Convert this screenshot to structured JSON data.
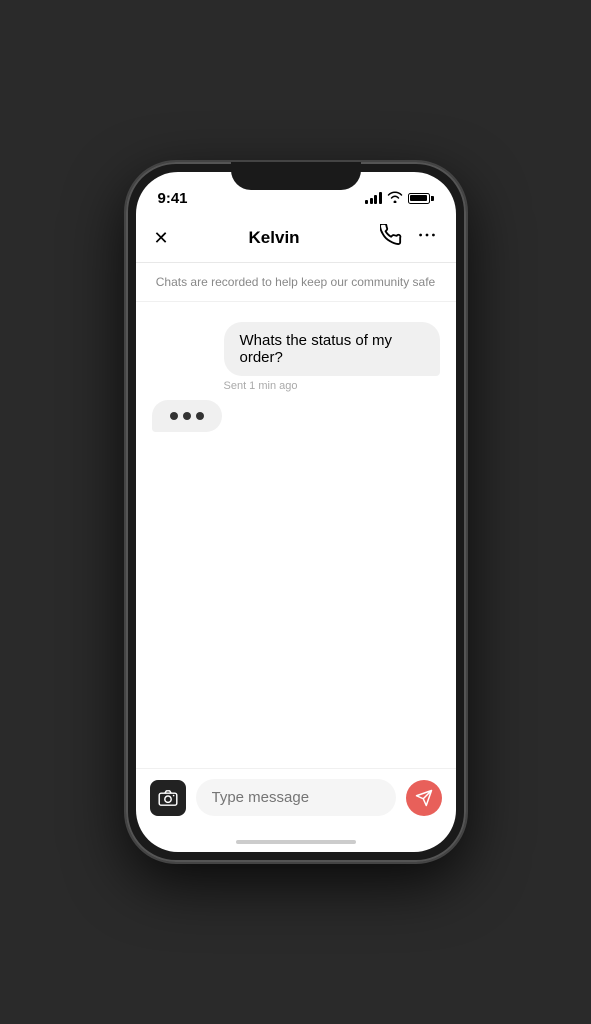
{
  "status_bar": {
    "time": "9:41"
  },
  "header": {
    "close_label": "✕",
    "title": "Kelvin",
    "more_label": "···"
  },
  "safety_notice": {
    "text": "Chats are recorded to help keep our community safe"
  },
  "messages": [
    {
      "type": "sent",
      "text": "Whats the status of my order?",
      "timestamp": "Sent 1 min ago"
    }
  ],
  "input": {
    "placeholder": "Type message"
  },
  "send_button_label": "Send"
}
